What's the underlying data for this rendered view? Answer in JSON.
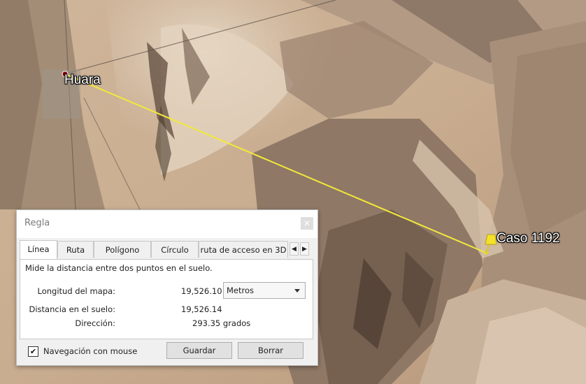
{
  "map": {
    "placemark_1": "Huara",
    "placemark_2": "Caso 1192",
    "path_color": "#f2e93a",
    "pin_color": "#f4e22a"
  },
  "dialog": {
    "title": "Regla",
    "close_icon": "close-icon",
    "tabs": [
      "Línea",
      "Ruta",
      "Polígono",
      "Círculo",
      "ruta de acceso en 3D"
    ],
    "active_tab": "Línea",
    "description": "Mide la distancia entre dos puntos en el suelo.",
    "map_length_label": "Longitud del mapa:",
    "map_length_value": "19,526.10",
    "units": "Metros",
    "ground_distance_label": "Distancia en el suelo:",
    "ground_distance_value": "19,526.14",
    "heading_label": "Dirección:",
    "heading_value": "293.35 grados",
    "mouse_nav_label": "Navegación con mouse",
    "mouse_nav_checked": true,
    "save_label": "Guardar",
    "clear_label": "Borrar"
  }
}
